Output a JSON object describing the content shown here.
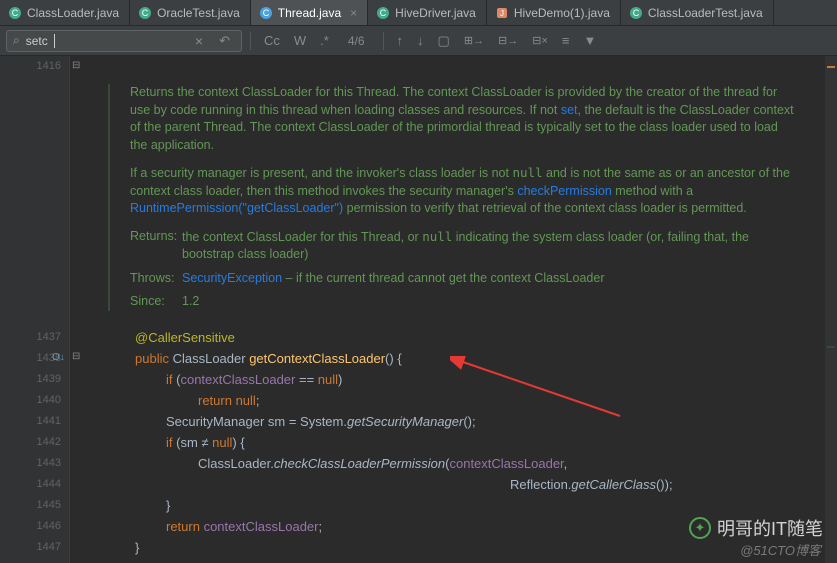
{
  "tabs": [
    {
      "icon": "c",
      "color": "#5a9",
      "label": "ClassLoader.java"
    },
    {
      "icon": "c",
      "color": "#5a9",
      "label": "OracleTest.java"
    },
    {
      "icon": "c",
      "color": "#5cf",
      "label": "Thread.java",
      "active": true
    },
    {
      "icon": "c",
      "color": "#5a9",
      "label": "HiveDriver.java"
    },
    {
      "icon": "j",
      "color": "#d86",
      "label": "HiveDemo(1).java"
    },
    {
      "icon": "c",
      "color": "#5a9",
      "label": "ClassLoaderTest.java"
    }
  ],
  "find": {
    "value": "setc",
    "count": "4/6",
    "cc": "Cc",
    "w": "W",
    "re": ".*"
  },
  "gutter": {
    "top": "1416",
    "lines": [
      "1437",
      "1438",
      "1439",
      "1440",
      "1441",
      "1442",
      "1443",
      "1444",
      "1445",
      "1446",
      "1447"
    ]
  },
  "doc": {
    "p1a": "Returns the context ClassLoader for this Thread. The context ClassLoader is provided by the creator of the thread for use by code running in this thread when loading classes and resources. If not ",
    "p1link": "set",
    "p1b": ", the default is the ClassLoader context of the parent Thread. The context ClassLoader of the primordial thread is typically set to the class loader used to load the application.",
    "p2a": "If a security manager is present, and the invoker's class loader is not ",
    "p2null": "null",
    "p2b": " and is not the same as or an ancestor of the context class loader, then this method invokes the security manager's ",
    "p2cp": "checkPermission",
    "p2c": " method with a ",
    "p2rp": "RuntimePermission",
    "p2d": "(\"getClassLoader\")",
    "p2e": " permission to verify that retrieval of the context class loader is permitted.",
    "rlab": "Returns:",
    "rtxt": "the context ClassLoader for this Thread, or ",
    "rnull": "null",
    "rtxt2": " indicating the system class loader (or, failing that, the bootstrap class loader)",
    "tlab": "Throws:",
    "tex": "SecurityException",
    "ttxt": " – if the current thread cannot get the context ClassLoader",
    "slab": "Since:",
    "sval": "1.2"
  },
  "code": {
    "l1": {
      "anno": "@CallerSensitive"
    },
    "l2": {
      "pub": "public ",
      "cl": "ClassLoader ",
      "m": "getContextClassLoader",
      "p": "() {"
    },
    "l3": {
      "if": "if ",
      "op": "(",
      "f": "contextClassLoader",
      "eq": " == ",
      "n": "null",
      "cp": ")"
    },
    "l4": {
      "ret": "return ",
      "n": "null",
      "s": ";"
    },
    "l5": {
      "t": "SecurityManager sm = System.",
      "m": "getSecurityManager",
      "p": "();"
    },
    "l6": {
      "if": "if ",
      "op": "(sm ",
      "ne": "≠",
      "sp": " ",
      "n": "null",
      "cp": ") {"
    },
    "l7": {
      "t": "ClassLoader.",
      "m": "checkClassLoaderPermission",
      "op": "(",
      "f": "contextClassLoader",
      "c": ","
    },
    "l8": {
      "t": "Reflection.",
      "m": "getCallerClass",
      "p": "());"
    },
    "l9": {
      "b": "}"
    },
    "l10": {
      "ret": "return ",
      "f": "contextClassLoader",
      "s": ";"
    },
    "l11": {
      "b": "}"
    }
  },
  "wm1": "明哥的IT随笔",
  "wm2": "@51CTO博客"
}
